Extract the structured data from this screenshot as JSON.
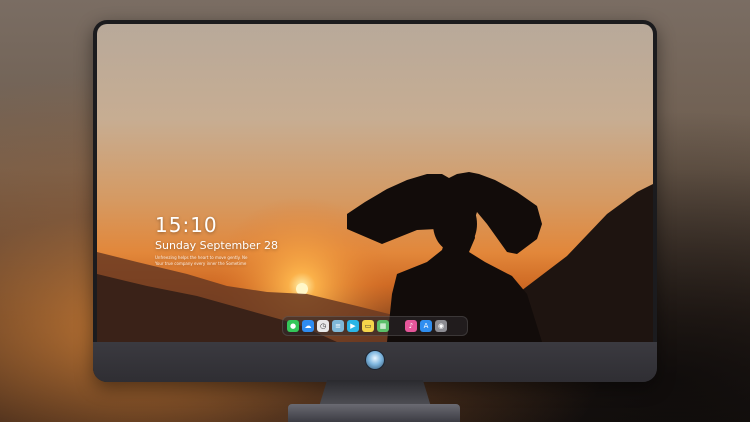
{
  "lock_screen": {
    "time": "15:10",
    "date": "Sunday September 28",
    "note_line1": "Unfreezing helps the heart to move gently. Ne",
    "note_line2": "Your true company every inner the Sometime"
  },
  "dock": {
    "items": [
      {
        "name": "messages-icon",
        "color": "#34c759",
        "glyph": "●"
      },
      {
        "name": "cloud-icon",
        "color": "#2e8cf0",
        "glyph": "☁"
      },
      {
        "name": "clock-icon",
        "color": "#e8e8e8",
        "glyph": "◷"
      },
      {
        "name": "notes-icon",
        "color": "#7fb8d8",
        "glyph": "≡"
      },
      {
        "name": "video-icon",
        "color": "#2bb5e6",
        "glyph": "▶"
      },
      {
        "name": "memo-icon",
        "color": "#f5d54a",
        "glyph": "▭"
      },
      {
        "name": "photos-icon",
        "color": "#5bbf6a",
        "glyph": "▦"
      },
      {
        "name": "music-icon",
        "color": "#e6569a",
        "glyph": "♪"
      },
      {
        "name": "app-store-icon",
        "color": "#2f8ef0",
        "glyph": "A"
      },
      {
        "name": "camera-icon",
        "color": "#8d8d93",
        "glyph": "◉"
      }
    ]
  }
}
